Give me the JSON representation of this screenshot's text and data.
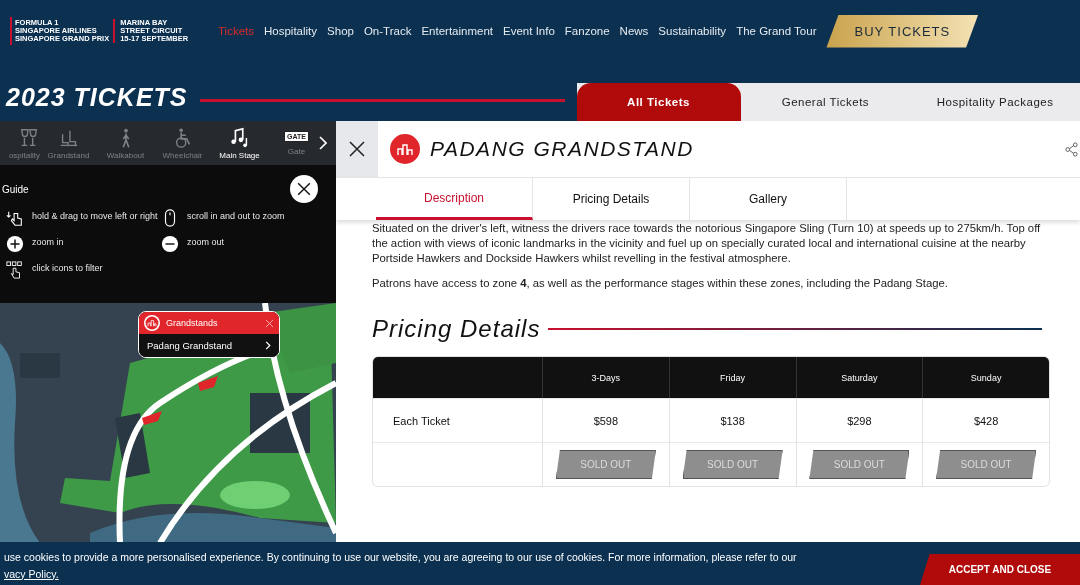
{
  "header": {
    "logo": {
      "line_1": "FORMULA 1",
      "line_2": "SINGAPORE AIRLINES",
      "line_3": "SINGAPORE GRAND PRIX",
      "line_4": "MARINA BAY",
      "line_5": "STREET CIRCUIT",
      "line_6": "15-17 SEPTEMBER"
    },
    "nav": [
      {
        "label": "Tickets",
        "selected": true
      },
      {
        "label": "Hospitality",
        "selected": false
      },
      {
        "label": "Shop",
        "selected": false
      },
      {
        "label": "On-Track",
        "selected": false
      },
      {
        "label": "Entertainment",
        "selected": false
      },
      {
        "label": "Event Info",
        "selected": false
      },
      {
        "label": "Fanzone",
        "selected": false
      },
      {
        "label": "News",
        "selected": false
      },
      {
        "label": "Sustainability",
        "selected": false
      },
      {
        "label": "The Grand Tour",
        "selected": false
      }
    ],
    "cta": "BUY TICKETS"
  },
  "page_title": "2023 TICKETS",
  "tabs": [
    {
      "label": "All Tickets",
      "selected": true
    },
    {
      "label": "General Tickets",
      "selected": false
    },
    {
      "label": "Hospitality Packages",
      "selected": false
    }
  ],
  "map": {
    "filters": [
      {
        "label": "ospitality",
        "kind": "glasses",
        "selected": false
      },
      {
        "label": "Grandstand",
        "kind": "seats",
        "selected": false
      },
      {
        "label": "Walkabout",
        "kind": "walker",
        "selected": false
      },
      {
        "label": "Wheelchair",
        "kind": "wheelchair",
        "selected": false
      },
      {
        "label": "Main Stage",
        "kind": "music",
        "selected": true
      },
      {
        "label": "Gate",
        "kind": "gate",
        "selected": false,
        "sign": "GATE"
      }
    ],
    "guide": {
      "title": "Guide",
      "tips": [
        {
          "kind": "drag",
          "text": "hold & drag to move left or right"
        },
        {
          "kind": "mouse",
          "text": "scroll in and out to zoom"
        },
        {
          "kind": "plus",
          "text": "zoom in"
        },
        {
          "kind": "minus",
          "text": "zoom out"
        },
        {
          "kind": "filter",
          "text": "click icons to filter"
        }
      ]
    },
    "popup": {
      "category": "Grandstands",
      "item": "Padang Grandstand"
    }
  },
  "detail": {
    "title": "PADANG GRANDSTAND",
    "tabs": [
      {
        "label": "Description",
        "selected": true
      },
      {
        "label": "Pricing Details",
        "selected": false
      },
      {
        "label": "Gallery",
        "selected": false
      }
    ],
    "paragraphs": [
      "Situated on the driver's left, witness the drivers race towards the notorious Singapore Sling (Turn 10) at speeds up to 275km/h. Top off the action with views of iconic landmarks in the vicinity and fuel up on specially curated local and international cuisine at the nearby Portside Hawkers and Dockside Hawkers whilst revelling in the festival atmosphere.",
      "Patrons have access to zone **4**, as well as the performance stages within these zones, including the Padang Stage."
    ],
    "pricing": {
      "heading": "Pricing Details",
      "columns": [
        "3-Days",
        "Friday",
        "Saturday",
        "Sunday"
      ],
      "rows": [
        {
          "label": "Each Ticket",
          "prices": [
            "$598",
            "$138",
            "$298",
            "$428"
          ]
        }
      ],
      "buttons": [
        {
          "label": "SOLD OUT",
          "disabled": true
        },
        {
          "label": "SOLD OUT",
          "disabled": true
        },
        {
          "label": "SOLD OUT",
          "disabled": true
        },
        {
          "label": "SOLD OUT",
          "disabled": true
        }
      ]
    }
  },
  "cookie_bar": {
    "text": "use cookies to provide a more personalised experience. By continuing to use our website, you are agreeing to our use of cookies. For more information, please refer to our",
    "link": "vacy Policy.",
    "button": "ACCEPT AND CLOSE"
  }
}
